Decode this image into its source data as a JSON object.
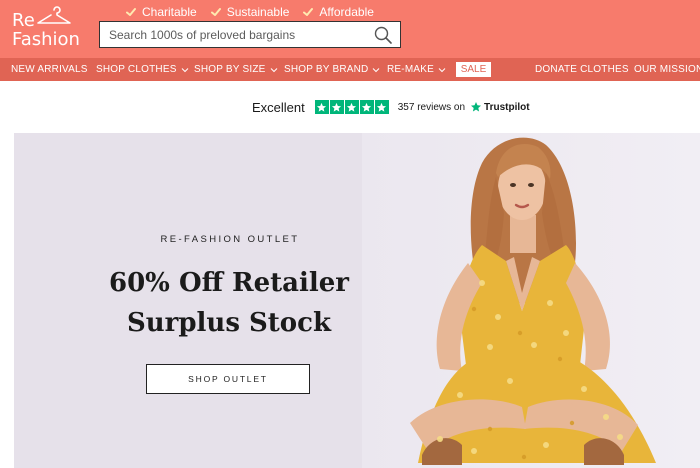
{
  "logo": {
    "line1": "Re",
    "line2": "Fashion",
    "icon": "hanger-icon"
  },
  "usps": [
    {
      "label": "Charitable",
      "icon": "check-icon"
    },
    {
      "label": "Sustainable",
      "icon": "check-icon"
    },
    {
      "label": "Affordable",
      "icon": "check-icon"
    }
  ],
  "search": {
    "placeholder": "Search 1000s of preloved bargains",
    "icon": "search-icon"
  },
  "nav": {
    "items": [
      {
        "label": "NEW ARRIVALS"
      },
      {
        "label": "SHOP CLOTHES",
        "dropdown": true
      },
      {
        "label": "SHOP BY SIZE",
        "dropdown": true
      },
      {
        "label": "SHOP BY BRAND",
        "dropdown": true
      },
      {
        "label": "RE-MAKE",
        "dropdown": true
      },
      {
        "label": "SALE"
      },
      {
        "label": "DONATE CLOTHES"
      },
      {
        "label": "OUR MISSION"
      }
    ]
  },
  "trustpilot": {
    "rating_text": "Excellent",
    "stars": 5,
    "reviews": "357 reviews on",
    "brand": "Trustpilot"
  },
  "hero": {
    "eyebrow": "RE-FASHION OUTLET",
    "heading_line1": "60% Off Retailer",
    "heading_line2": "Surplus Stock",
    "cta": "SHOP OUTLET"
  },
  "colors": {
    "header_bg": "#f77b6c",
    "nav_bg": "#e06454",
    "trustpilot_green": "#00b67a",
    "hero_bg": "#e6e1ea",
    "dress_yellow": "#e8b53a"
  }
}
